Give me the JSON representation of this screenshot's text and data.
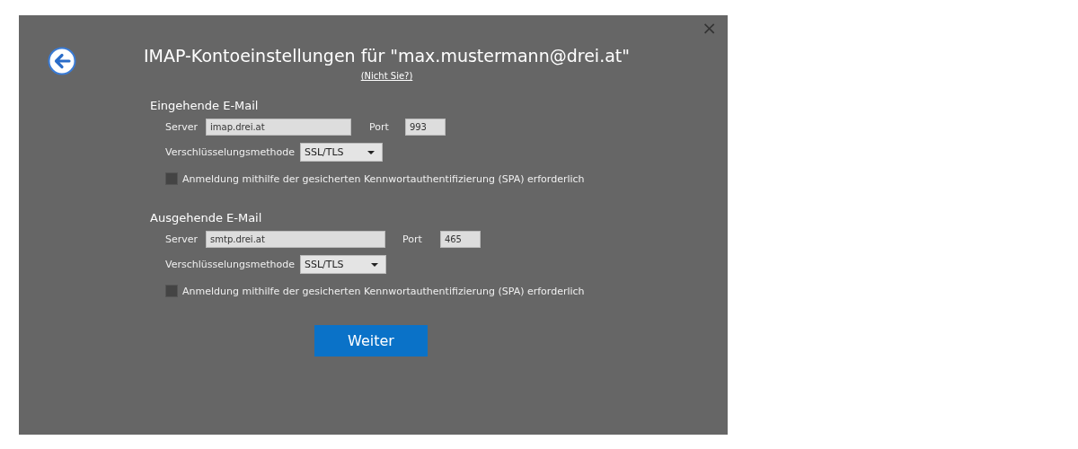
{
  "dialog": {
    "title": "IMAP-Kontoeinstellungen für \"max.mustermann@drei.at\"",
    "not_you_link": "(Nicht Sie?)",
    "close": "×"
  },
  "sections": [
    {
      "heading": "Eingehende E-Mail",
      "server_label": "Server",
      "server": "imap.drei.at",
      "port_label": "Port",
      "port": "993",
      "encryption_label": "Verschlüsselungsmethode",
      "encryption": "SSL/TLS",
      "spa_label": "Anmeldung mithilfe der gesicherten Kennwortauthentifizierung (SPA) erforderlich",
      "spa_checked": false
    },
    {
      "heading": "Ausgehende E-Mail",
      "server_label": "Server",
      "server": "smtp.drei.at",
      "port_label": "Port",
      "port": "465",
      "encryption_label": "Verschlüsselungsmethode",
      "encryption": "SSL/TLS",
      "spa_label": "Anmeldung mithilfe der gesicherten Kennwortauthentifizierung (SPA) erforderlich",
      "spa_checked": false
    }
  ],
  "next_button": "Weiter"
}
